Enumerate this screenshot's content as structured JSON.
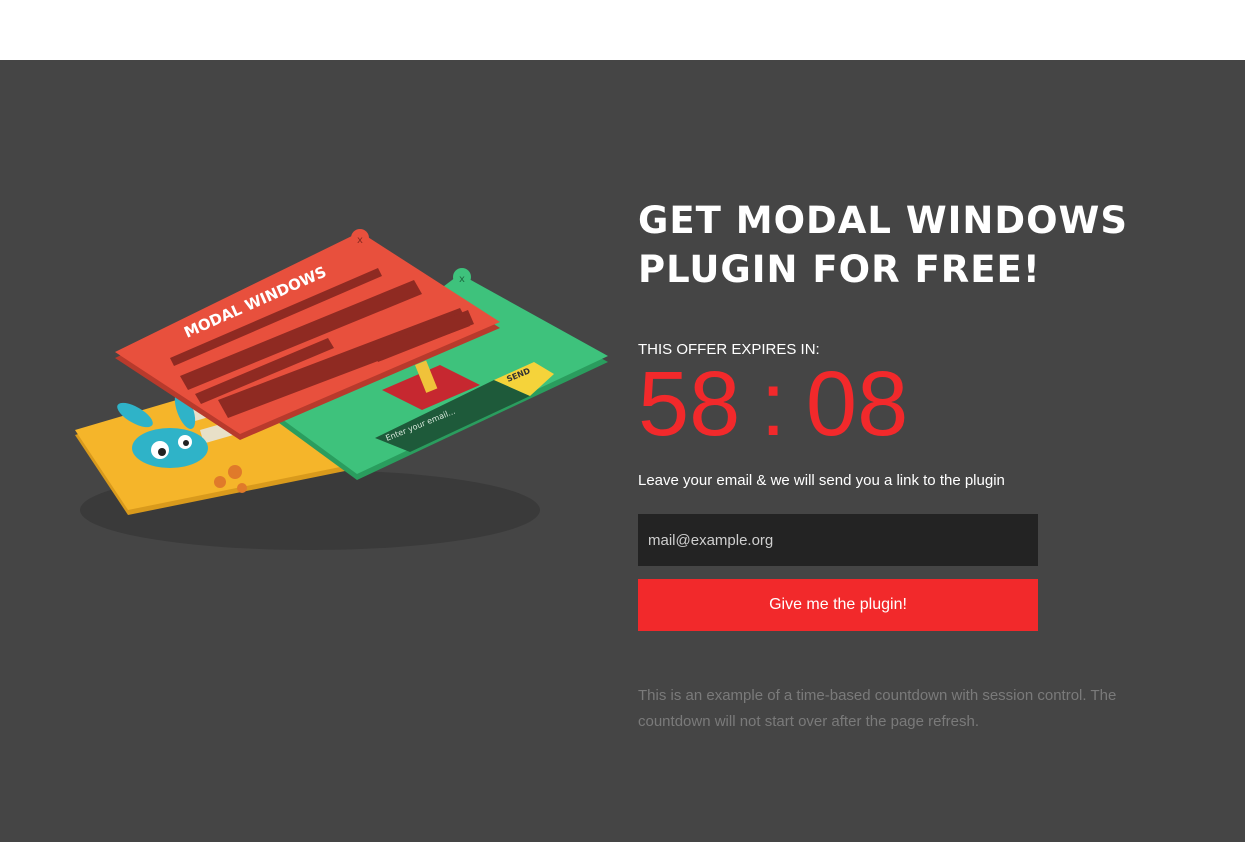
{
  "heading": {
    "line1": "GET MODAL WINDOWS",
    "line2": "PLUGIN FOR FREE!"
  },
  "offer": {
    "label": "THIS OFFER EXPIRES IN:",
    "minutes": "58",
    "separator": ":",
    "seconds": "08"
  },
  "form": {
    "lead": "Leave your email & we will send you a link to the plugin",
    "email_placeholder": "mail@example.org",
    "submit_label": "Give me the plugin!"
  },
  "note": "This is an example of a time-based countdown with session control. The countdown will not start over after the page refresh.",
  "illustration": {
    "red_card_title": "MODAL WINDOWS",
    "green_card_input": "Enter your email...",
    "green_card_button": "SEND",
    "close_glyph": "x"
  },
  "colors": {
    "background": "#454545",
    "accent": "#f2292b",
    "input_bg": "#232323"
  }
}
